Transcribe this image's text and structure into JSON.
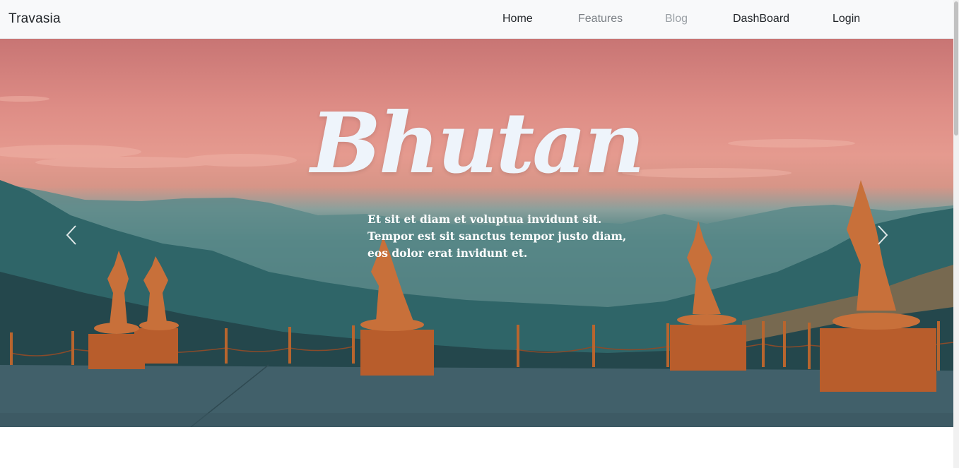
{
  "navbar": {
    "brand": "Travasia",
    "links": [
      {
        "label": "Home",
        "state": "active"
      },
      {
        "label": "Features",
        "state": "muted"
      },
      {
        "label": "Blog",
        "state": "faded"
      },
      {
        "label": "DashBoard",
        "state": "normal"
      },
      {
        "label": "Login",
        "state": "normal"
      }
    ]
  },
  "hero": {
    "title": "Bhutan",
    "text_lines": [
      "Et sit et diam et voluptua invidunt sit.",
      "Tempor est sit sanctus tempor justo diam,",
      "eos dolor erat invidunt et."
    ],
    "prev_icon": "chevron-left-icon",
    "next_icon": "chevron-right-icon"
  },
  "colors": {
    "title": "#eef4fb",
    "statue": "#c8703a",
    "sky_top": "#c87574",
    "mountain": "#2d6165"
  }
}
